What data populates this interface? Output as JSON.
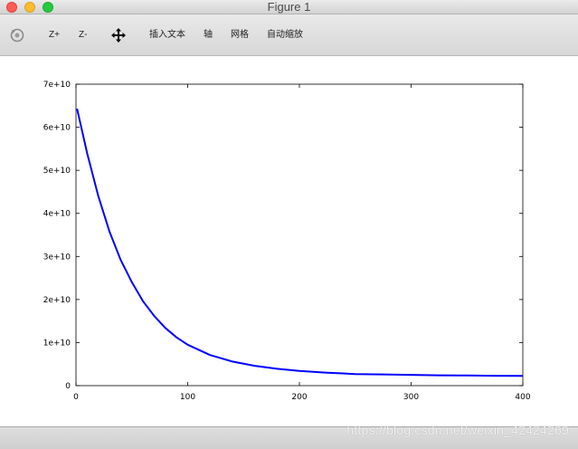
{
  "window": {
    "title": "Figure 1"
  },
  "toolbar": {
    "rotate_icon": "rotate-icon",
    "zoom_in_label": "Z+",
    "zoom_out_label": "Z-",
    "pan_icon": "pan-move-icon",
    "insert_text_label": "插入文本",
    "axis_label": "轴",
    "grid_label": "网格",
    "autoscale_label": "自动缩放"
  },
  "watermark": {
    "text": "https://blog.csdn.net/weixin_42424269"
  },
  "colors": {
    "line": "#0000ff",
    "axes": "#000000"
  },
  "chart_data": {
    "type": "line",
    "title": "",
    "xlabel": "",
    "ylabel": "",
    "xlim": [
      0,
      400
    ],
    "ylim": [
      0,
      70000000000.0
    ],
    "xticks": [
      0,
      100,
      200,
      300,
      400
    ],
    "xtick_labels": [
      "0",
      "100",
      "200",
      "300",
      "400"
    ],
    "yticks": [
      0,
      10000000000.0,
      20000000000.0,
      30000000000.0,
      40000000000.0,
      50000000000.0,
      60000000000.0,
      70000000000.0
    ],
    "ytick_labels": [
      "0",
      "1e+10",
      "2e+10",
      "3e+10",
      "4e+10",
      "5e+10",
      "6e+10",
      "7e+10"
    ],
    "grid": false,
    "series": [
      {
        "x": [
          1,
          10,
          20,
          30,
          40,
          50,
          60,
          70,
          80,
          90,
          100,
          120,
          140,
          160,
          180,
          200,
          225,
          250,
          275,
          300,
          325,
          350,
          375,
          400
        ],
        "y": [
          64300000000.0,
          54000000000.0,
          44000000000.0,
          35800000000.0,
          29200000000.0,
          24000000000.0,
          19600000000.0,
          16200000000.0,
          13400000000.0,
          11200000000.0,
          9500000000.0,
          7100000000.0,
          5600000000.0,
          4600000000.0,
          3900000000.0,
          3400000000.0,
          3000000000.0,
          2700000000.0,
          2600000000.0,
          2500000000.0,
          2400000000.0,
          2350000000.0,
          2300000000.0,
          2250000000.0
        ]
      }
    ]
  }
}
